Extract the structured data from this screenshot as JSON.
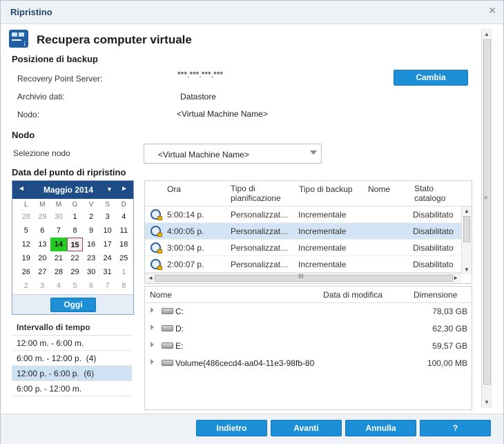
{
  "window": {
    "title": "Ripristino",
    "close": "✕"
  },
  "header": {
    "title": "Recupera computer virtuale",
    "icon": "restore-vm-icon"
  },
  "backup_location": {
    "section": "Posizione di backup",
    "rps_label": "Recovery Point Server:",
    "rps_value": "***.***.***.***",
    "datastore_label": "Archivio dati:",
    "datastore_value": "Datastore",
    "node_label": "Nodo:",
    "node_value": "<Virtual Machine Name>",
    "change_button": "Cambia"
  },
  "node": {
    "section": "Nodo",
    "select_label": "Selezione nodo",
    "selected": "<Virtual Machine Name>"
  },
  "restore_point_date": {
    "section": "Data del punto di ripristino",
    "calendar": {
      "month": "Maggio 2014",
      "prev": "◄",
      "next": "►",
      "dropdown": "▼",
      "weekdays": [
        "L",
        "M",
        "M",
        "G",
        "V",
        "S",
        "D"
      ],
      "weeks": [
        [
          "28",
          "29",
          "30",
          "1",
          "2",
          "3",
          "4"
        ],
        [
          "5",
          "6",
          "7",
          "8",
          "9",
          "10",
          "11"
        ],
        [
          "12",
          "13",
          "14",
          "15",
          "16",
          "17",
          "18"
        ],
        [
          "19",
          "20",
          "21",
          "22",
          "23",
          "24",
          "25"
        ],
        [
          "26",
          "27",
          "28",
          "29",
          "30",
          "31",
          "1"
        ],
        [
          "2",
          "3",
          "4",
          "5",
          "6",
          "7",
          "8"
        ]
      ],
      "today_button": "Oggi"
    }
  },
  "time_interval": {
    "title": "Intervallo di tempo",
    "items": [
      {
        "label": "12:00 m. - 6:00 m.",
        "count": ""
      },
      {
        "label": "6:00 m. - 12:00 p.",
        "count": "(4)"
      },
      {
        "label": "12:00 p. - 6:00 p.",
        "count": "(6)"
      },
      {
        "label": "6:00 p. - 12:00 m.",
        "count": ""
      }
    ]
  },
  "recovery_points": {
    "headers": [
      "Ora",
      "Tipo di pianificazione",
      "Tipo di backup",
      "Nome",
      "Stato catalogo"
    ],
    "rows": [
      {
        "time": "5:00:14 p.",
        "schedule": "Personalizzat…",
        "backup": "Incrementale",
        "name": "",
        "catalog": "Disabilitato"
      },
      {
        "time": "4:00:05 p.",
        "schedule": "Personalizzat…",
        "backup": "Incrementale",
        "name": "",
        "catalog": "Disabilitato"
      },
      {
        "time": "3:00:04 p.",
        "schedule": "Personalizzat…",
        "backup": "Incrementale",
        "name": "",
        "catalog": "Disabilitato"
      },
      {
        "time": "2:00:07 p.",
        "schedule": "Personalizzat…",
        "backup": "Incrementale",
        "name": "",
        "catalog": "Disabilitato"
      }
    ],
    "grip": "III"
  },
  "files": {
    "headers": {
      "name": "Nome",
      "modified": "Data di modifica",
      "size": "Dimensione"
    },
    "rows": [
      {
        "name": "C:",
        "size": "78,03 GB"
      },
      {
        "name": "D:",
        "size": "62,30 GB"
      },
      {
        "name": "E:",
        "size": "59,57 GB"
      },
      {
        "name": "Volume{486cecd4-aa04-11e3-98fb-80",
        "size": "100,00 MB"
      }
    ]
  },
  "footer": {
    "back": "Indietro",
    "next": "Avanti",
    "cancel": "Annulla",
    "help": "?"
  }
}
